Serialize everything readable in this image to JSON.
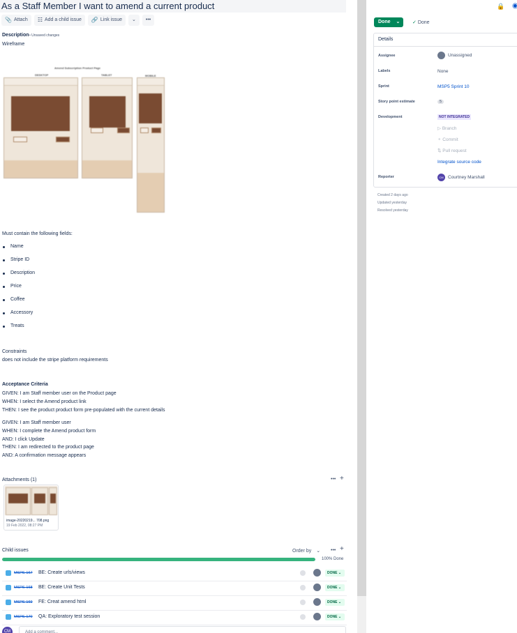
{
  "issue": {
    "title": "As a Staff Member I want to amend a current product"
  },
  "toolbar": {
    "attach_label": "Attach",
    "add_child_label": "Add a child issue",
    "link_issue_label": "Link issue",
    "more_label": "•••"
  },
  "description": {
    "label": "Description",
    "unsaved": "• Unsaved changes",
    "wireframe_label": "Wireframe",
    "wireframe_title": "Amend Subscription Product Page",
    "wireframe_captions": [
      "DESKTOP",
      "TABLET",
      "MOBILE"
    ],
    "fields_intro": "Must contain the following fields:",
    "fields": [
      "Name",
      "Stripe ID",
      "Description",
      "Price",
      "Coffee",
      "Accessory",
      "Treats"
    ],
    "constraints_heading": "Constraints",
    "constraints_text": "does not include the stripe platform requirements",
    "acceptance_heading": "Acceptance Criteria",
    "criteria_block1": [
      "GIVEN: I am Staff member user on the Product page",
      "WHEN: I select the Amend product link",
      "THEN: I see the product product form pre-populated with the current details"
    ],
    "criteria_block2": [
      "GIVEN: I am Staff member user",
      "WHEN: I complete the Amend product form",
      "AND: I click Update",
      "THEN: I am redirected to the product page",
      "AND: A confirmation message appears"
    ]
  },
  "attachments": {
    "label": "Attachments (1)",
    "more": "•••",
    "add": "+",
    "file_name": "image-20220219... 708.png",
    "file_date": "19 Feb 2022, 08:27 PM"
  },
  "child_issues": {
    "label": "Child issues",
    "order_by": "Order by",
    "more": "•••",
    "add": "+",
    "progress_percent": 100,
    "progress_label": "100% Done",
    "items": [
      {
        "key": "MSPS-167",
        "summary": "BE: Create urls/views",
        "status": "DONE"
      },
      {
        "key": "MSPS-168",
        "summary": "BE: Create Unit Tests",
        "status": "DONE"
      },
      {
        "key": "MSPS-169",
        "summary": "FE: Creat amend html",
        "status": "DONE"
      },
      {
        "key": "MSPS-170",
        "summary": "QA: Exploratory test session",
        "status": "DONE"
      }
    ]
  },
  "comment": {
    "avatar_initials": "CM",
    "placeholder": "Add a comment..."
  },
  "sidebar": {
    "status_button": "Done",
    "resolution": "Done",
    "details_heading": "Details",
    "fields": [
      {
        "label": "Assignee",
        "value": "Unassigned"
      },
      {
        "label": "Labels",
        "value": "None"
      },
      {
        "label": "Sprint",
        "value": "MSP5 Sprint 10"
      },
      {
        "label": "Story point estimate",
        "value": "5"
      },
      {
        "label": "Development",
        "value": "NOT INTEGRATED"
      },
      {
        "label": "Reporter",
        "value": "Courtney Marshall"
      }
    ],
    "dev_links": [
      "Branch",
      "Commit",
      "Pull request"
    ],
    "integrate_link": "Integrate source code",
    "reporter_initials": "CM",
    "created": "Created 2 days ago",
    "updated": "Updated yesterday",
    "resolved": "Resolved yesterday"
  },
  "colors": {
    "done_green": "#00875a",
    "progress_green": "#36b37e",
    "link_blue": "#0052cc",
    "wireframe_brown": "#7a4b32"
  }
}
